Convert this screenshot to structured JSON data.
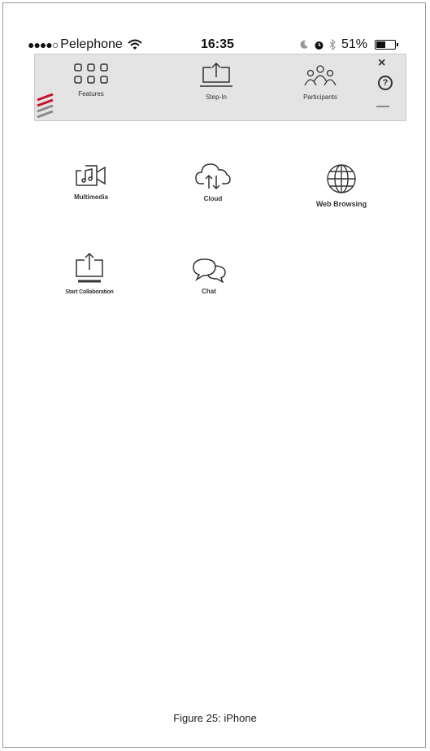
{
  "status_bar": {
    "signal": "●●●●○",
    "carrier": "Pelephone",
    "time": "16:35",
    "battery_percent": "51%",
    "battery_level": 0.51
  },
  "toolbar": {
    "features_label": "Features",
    "stepin_label": "Step-In",
    "participants_label": "Participants",
    "close_glyph": "×",
    "help_glyph": "?"
  },
  "features": {
    "multimedia": "Multimedia",
    "cloud": "Cloud",
    "web_browsing": "Web Browsing",
    "start_collaboration": "Start Collaboration",
    "chat": "Chat"
  },
  "caption": "Figure 25: iPhone",
  "colors": {
    "toolbar_bg": "#e4e4e4",
    "logo_red": "#c8102e",
    "logo_gray": "#8a8a8a"
  }
}
